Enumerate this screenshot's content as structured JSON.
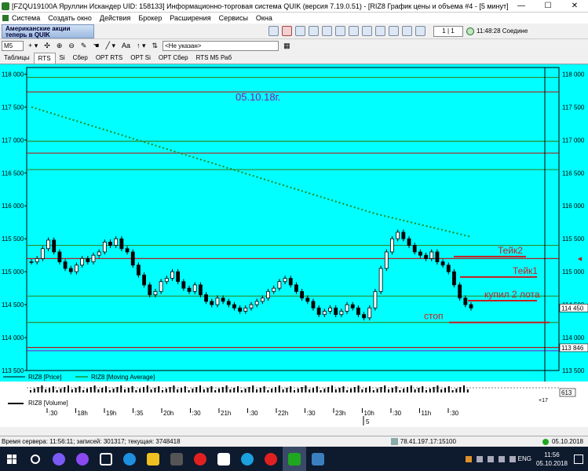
{
  "window": {
    "title": "[FZQU19100A Яруллин Искандер UID: 158133] Информационно-торговая система QUIK (версия 7.19.0.51) - [RIZ8 График цены и объема #4 - [5 минут]]",
    "minimize": "—",
    "maximize": "☐",
    "close": "✕"
  },
  "menu": [
    "Система",
    "Создать окно",
    "Действия",
    "Брокер",
    "Расширения",
    "Сервисы",
    "Окна"
  ],
  "toolbar": {
    "banner_line1": "Американские акции",
    "banner_line2": "теперь в QUIK",
    "page_indicator": "1 | 1",
    "clock_text": "11:48:28 Соедине"
  },
  "chart_toolbar": {
    "interval": "M5",
    "text_tool": "Aa",
    "account_select": "<Не указан>"
  },
  "tabs": [
    "Таблицы",
    "RTS",
    "Si",
    "Сбер",
    "OPT RTS",
    "OPT Si",
    "OPT Сбер",
    "RTS M5 Раб"
  ],
  "active_tab": "RTS",
  "chart_data": {
    "type": "line",
    "instrument": "RIZ8",
    "ylim": [
      113500,
      118100
    ],
    "y_ticks": [
      113500,
      114000,
      114500,
      115000,
      115500,
      116000,
      116500,
      117000,
      117500,
      118000
    ],
    "y_tick_labels": [
      "113 500",
      "114 000",
      "114 500",
      "115 000",
      "115 500",
      "116 000",
      "116 500",
      "117 000",
      "117 500",
      "118 000"
    ],
    "time_labels": [
      ":30",
      "18h",
      "19h",
      ":35",
      "20h",
      ":30",
      "21h",
      ":30",
      "22h",
      ":30",
      "23h",
      "10h",
      ":30",
      "11h",
      ":30"
    ],
    "day_marker": "5",
    "annotation_date": "05.10.18г.",
    "horizontal_lines": [
      {
        "value": 117950,
        "color": "#2e8b2e"
      },
      {
        "value": 117730,
        "color": "#b02020"
      },
      {
        "value": 116980,
        "color": "#2e8b2e"
      },
      {
        "value": 116800,
        "color": "#b02020"
      },
      {
        "value": 116550,
        "color": "#2e8b2e"
      },
      {
        "value": 115200,
        "color": "#b02020"
      },
      {
        "value": 115400,
        "color": "#2e8b2e"
      },
      {
        "value": 114630,
        "color": "#2e8b2e"
      },
      {
        "value": 114230,
        "color": "#2e8b2e"
      },
      {
        "value": 113850,
        "color": "#b02020"
      },
      {
        "value": 113800,
        "color": "#7030c0"
      }
    ],
    "moving_average_start": 117500,
    "moving_average_end": 115530,
    "price_series": [
      115150,
      115200,
      115350,
      115480,
      115300,
      115150,
      115050,
      115000,
      115100,
      115200,
      115150,
      115250,
      115300,
      115450,
      115400,
      115500,
      115350,
      115300,
      115100,
      114950,
      114800,
      114650,
      114700,
      114850,
      114900,
      115000,
      114850,
      114750,
      114700,
      114800,
      114650,
      114550,
      114500,
      114600,
      114550,
      114500,
      114450,
      114400,
      114450,
      114500,
      114550,
      114600,
      114700,
      114750,
      114850,
      114900,
      114800,
      114700,
      114600,
      114550,
      114450,
      114350,
      114400,
      114450,
      114350,
      114400,
      114500,
      114450,
      114350,
      114300,
      114450,
      114700,
      115050,
      115300,
      115500,
      115600,
      115500,
      115400,
      115300,
      115250,
      115200,
      115300,
      115150,
      115100,
      115000,
      114800,
      114600,
      114500,
      114450
    ],
    "right_markers": [
      {
        "value": 114450,
        "label": "114 450"
      },
      {
        "value": 113846,
        "label": "113 846"
      }
    ],
    "annotations": [
      {
        "label": "Тейк2",
        "value": 115230
      },
      {
        "label": "Тейк1",
        "value": 114920
      },
      {
        "label": "купил 2 лота",
        "value": 114560
      },
      {
        "label": "стоп",
        "value": 114230
      }
    ],
    "legend": [
      {
        "name": "RIZ8 [Price]",
        "color": "#000000"
      },
      {
        "name": "RIZ8 [Moving Average]",
        "color": "#1e8a1e"
      }
    ],
    "volume_label": "RIZ8 [Volume]",
    "volume_marker": "613",
    "volume_sub_marker": "+17"
  },
  "status": {
    "server_time": "Время сервера: 11:56:11; записей: 301317; текущая: 3748418",
    "connection": "78.41.197.17:15100",
    "date": "05.10.2018"
  },
  "taskbar": {
    "lang": "ENG",
    "time": "11:56",
    "date": "05.10.2018"
  },
  "colors": {
    "chart_bg": "#00ffff",
    "annotation_red": "#c81e1e",
    "annotation_date": "#8a1aa0"
  }
}
